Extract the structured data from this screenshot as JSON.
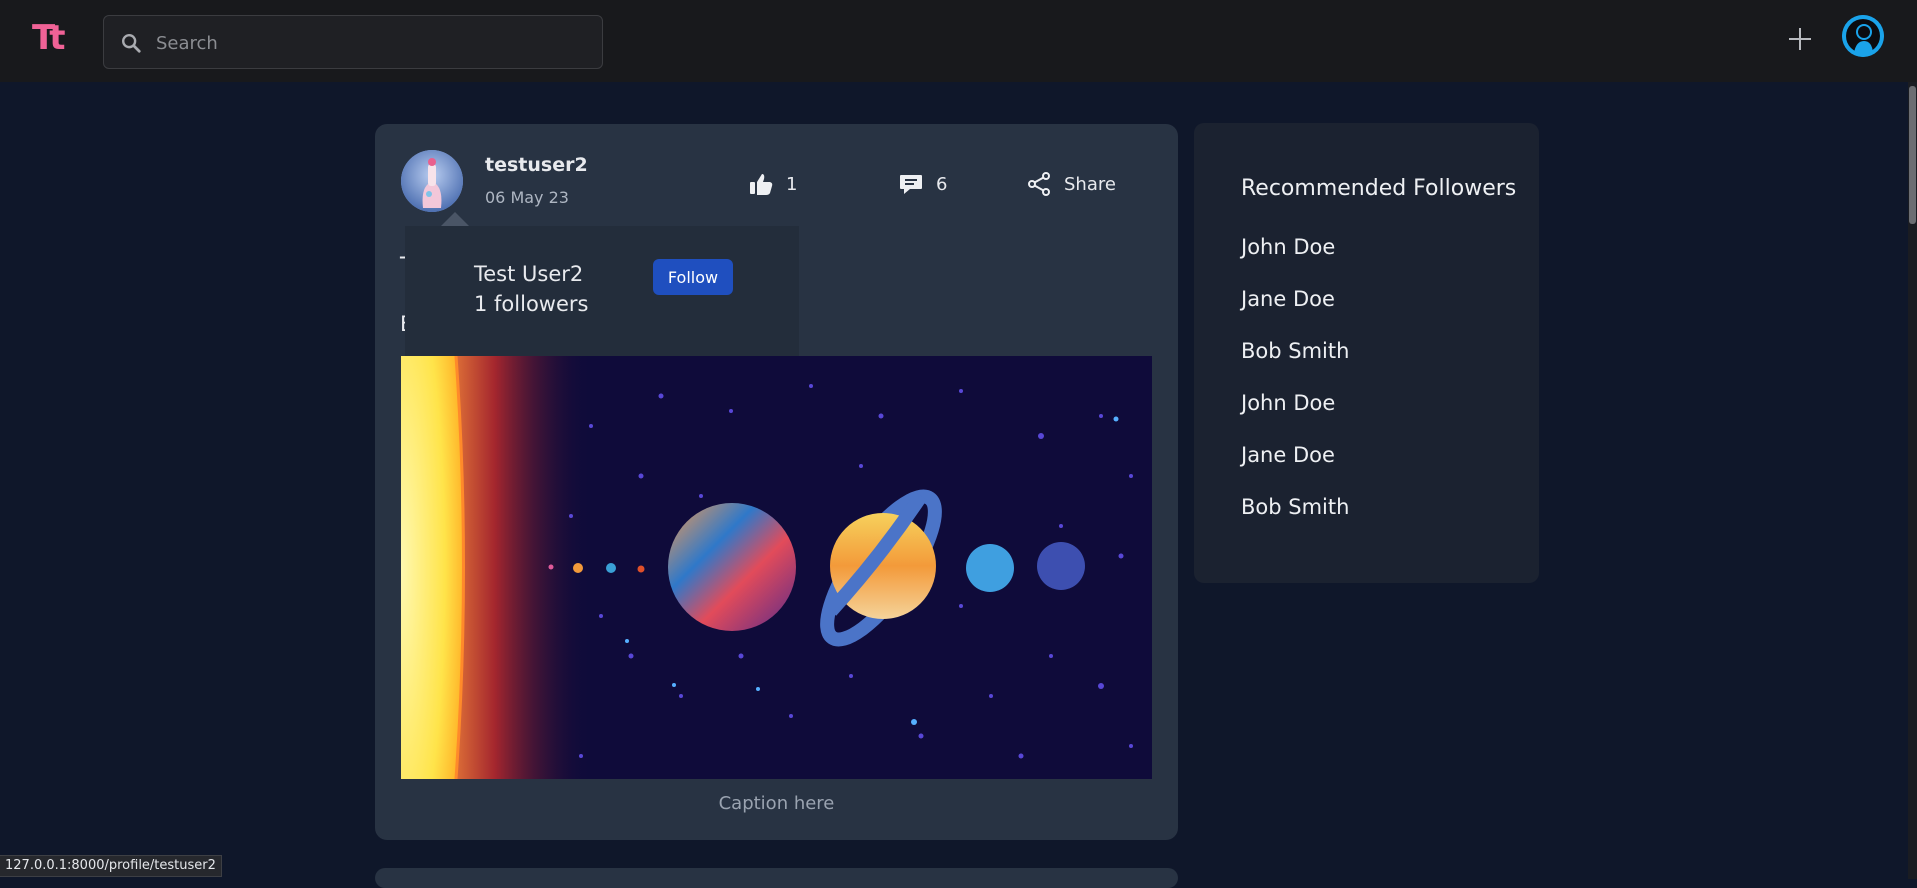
{
  "header": {
    "logo": "Tt",
    "search_placeholder": "Search",
    "colors": {
      "logo": "#f06296",
      "bar": "#18191c",
      "avatar": "#1aa3ea"
    },
    "icons": {
      "search": "search-icon",
      "create": "plus-icon",
      "profile": "user-avatar-icon"
    }
  },
  "post": {
    "username": "testuser2",
    "date": "06 May 23",
    "likes": "1",
    "comments": "6",
    "share_label": "Share",
    "title_peek": "T",
    "body_peek": "E",
    "caption": "Caption here",
    "icons": {
      "like": "thumbs-up-icon",
      "comment": "comment-icon",
      "share": "share-icon"
    }
  },
  "hover_card": {
    "name": "Test User2",
    "followers": "1 followers",
    "follow_label": "Follow",
    "colors": {
      "follow_button": "#1f4fbf"
    }
  },
  "recommended": {
    "title": "Recommended Followers",
    "items": [
      "John Doe",
      "Jane Doe",
      "Bob Smith",
      "John Doe",
      "Jane Doe",
      "Bob Smith"
    ]
  },
  "status_bar": {
    "url": "127.0.0.1:8000/profile/testuser2"
  }
}
